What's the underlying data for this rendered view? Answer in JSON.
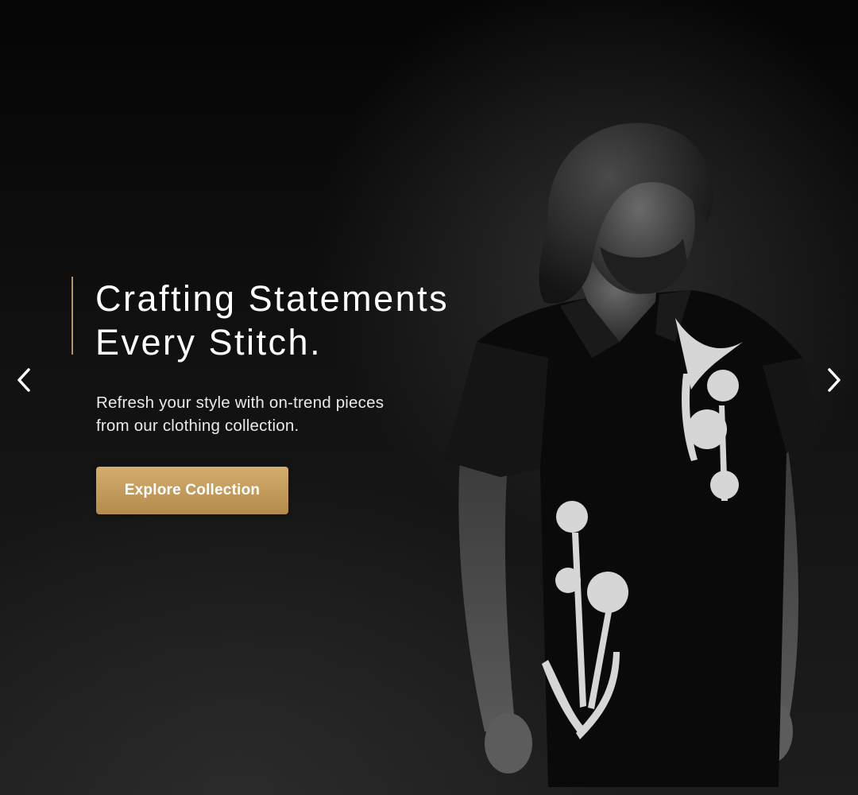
{
  "hero": {
    "headline_line1": "Crafting Statements",
    "headline_line2": "Every Stitch.",
    "subtext_line1": "Refresh your style with on-trend pieces",
    "subtext_line2": "from our clothing collection.",
    "cta_label": "Explore Collection"
  },
  "navigation": {
    "prev_icon": "chevron-left-icon",
    "next_icon": "chevron-right-icon"
  },
  "colors": {
    "accent": "#b8936a",
    "button_gold": "#c49d5d",
    "background": "#0b0b0b",
    "text": "#ffffff"
  }
}
